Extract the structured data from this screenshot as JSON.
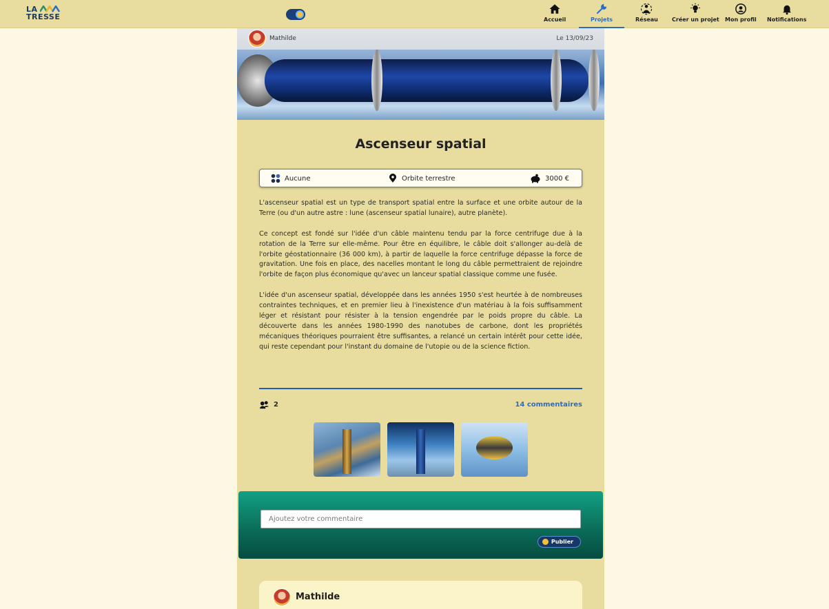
{
  "brand": {
    "line1": "LA",
    "line2": "TRESSE"
  },
  "nav": [
    {
      "label": "Accueil",
      "icon": "home-icon"
    },
    {
      "label": "Projets",
      "icon": "tools-icon",
      "active": true
    },
    {
      "label": "Réseau",
      "icon": "network-icon"
    },
    {
      "label": "Créer un projet",
      "icon": "lightbulb-icon"
    },
    {
      "label": "Mon profil",
      "icon": "user-circle-icon"
    },
    {
      "label": "Notifications",
      "icon": "bell-icon"
    }
  ],
  "post": {
    "author": "Mathilde",
    "date": "Le 13/09/23",
    "title": "Ascenseur spatial",
    "category": "Aucune",
    "location": "Orbite terrestre",
    "budget": "3000 €",
    "paragraphs": [
      "L'ascenseur spatial est un type de transport spatial entre la surface et une orbite autour de la Terre (ou d'un autre astre : lune (ascenseur spatial lunaire), autre planète).",
      "Ce concept est fondé sur l'idée d'un câble maintenu tendu par la force centrifuge due à la rotation de la Terre sur elle-même. Pour être en équilibre, le câble doit s'allonger au-delà de l'orbite géostationnaire (36 000 km), à partir de laquelle la force centrifuge dépasse la force de gravitation. Une fois en place, des nacelles montant le long du câble permettraient de rejoindre l'orbite de façon plus économique qu'avec un lanceur spatial classique comme une fusée.",
      "L'idée d'un ascenseur spatial, développée dans les années 1950 s'est heurtée à de nombreuses contraintes techniques, et en premier lieu à l'inexistence d'un matériau à la fois suffisamment léger et résistant pour résister à la tension engendrée par le poids propre du câble. La découverte dans les années 1980-1990 des nanotubes de carbone, dont les propriétés mécaniques théoriques pourraient être suffisantes, a relancé un certain intérêt pour cette idée, qui reste cependant pour l'instant du domaine de l'utopie ou de la science fiction."
    ],
    "likes": "2",
    "comments_count": "14 commentaires"
  },
  "comment_form": {
    "placeholder": "Ajoutez votre commentaire",
    "publish_label": "Publier"
  },
  "first_comment": {
    "author": "Mathilde"
  },
  "colors": {
    "background": "#fdf8e4",
    "panel": "#e8dd9f",
    "accent": "#2a6cc7",
    "comment_box": "#0a6a57"
  }
}
